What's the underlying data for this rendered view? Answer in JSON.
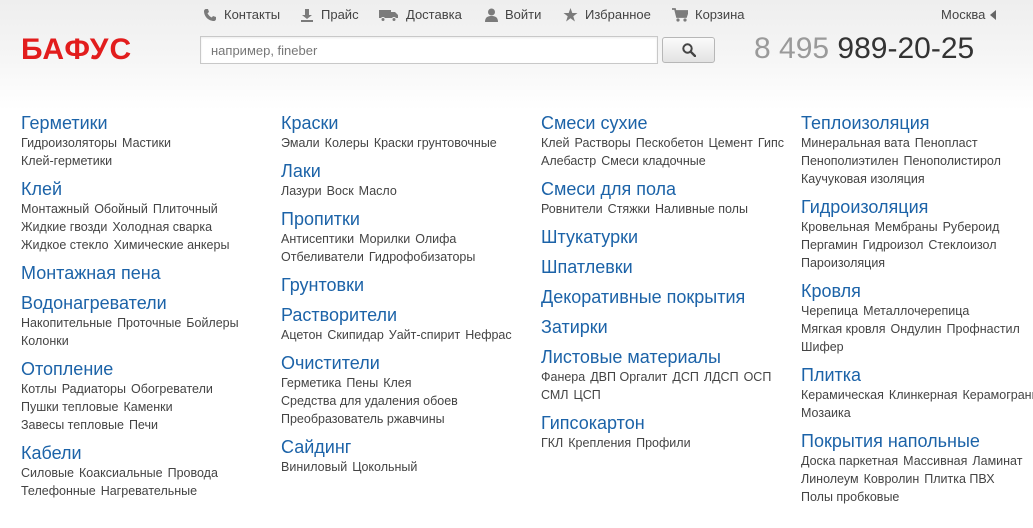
{
  "topnav": {
    "contacts": "Контакты",
    "price": "Прайс",
    "delivery": "Доставка",
    "login": "Войти",
    "favorites": "Избранное",
    "cart": "Корзина"
  },
  "city": "Москва",
  "logo": "БАФУС",
  "search": {
    "placeholder": "например, fineber"
  },
  "phone": {
    "code": "8 495",
    "number": "989-20-25"
  },
  "colors": {
    "brand": "#e21d1d",
    "link": "#1c63a8"
  },
  "columns": [
    [
      {
        "title": "Герметики",
        "subs": [
          "Гидроизоляторы",
          "Мастики",
          "Клей-герметики"
        ]
      },
      {
        "title": "Клей",
        "subs": [
          "Монтажный",
          "Обойный",
          "Плиточный",
          "Жидкие гвозди",
          "Холодная сварка",
          "Жидкое стекло",
          "Химические анкеры"
        ]
      },
      {
        "title": "Монтажная пена",
        "subs": []
      },
      {
        "title": "Водонагреватели",
        "subs": [
          "Накопительные",
          "Проточные",
          "Бойлеры",
          "Колонки"
        ]
      },
      {
        "title": "Отопление",
        "subs": [
          "Котлы",
          "Радиаторы",
          "Обогреватели",
          "Пушки тепловые",
          "Каменки",
          "Завесы тепловые",
          "Печи"
        ]
      },
      {
        "title": "Кабели",
        "subs": [
          "Силовые",
          "Коаксиальные",
          "Провода",
          "Телефонные",
          "Нагревательные"
        ]
      }
    ],
    [
      {
        "title": "Краски",
        "subs": [
          "Эмали",
          "Колеры",
          "Краски грунтовочные"
        ]
      },
      {
        "title": "Лаки",
        "subs": [
          "Лазури",
          "Воск",
          "Масло"
        ]
      },
      {
        "title": "Пропитки",
        "subs": [
          "Антисептики",
          "Морилки",
          "Олифа",
          "Отбеливатели",
          "Гидрофобизаторы"
        ]
      },
      {
        "title": "Грунтовки",
        "subs": []
      },
      {
        "title": "Растворители",
        "subs": [
          "Ацетон",
          "Скипидар",
          "Уайт-спирит",
          "Нефрас"
        ]
      },
      {
        "title": "Очистители",
        "subs": [
          "Герметика",
          "Пены",
          "Клея",
          "Средства для удаления обоев",
          "Преобразователь ржавчины"
        ]
      },
      {
        "title": "Сайдинг",
        "subs": [
          "Виниловый",
          "Цокольный"
        ]
      }
    ],
    [
      {
        "title": "Смеси сухие",
        "subs": [
          "Клей",
          "Растворы",
          "Пескобетон",
          "Цемент",
          "Гипс",
          "Алебастр",
          "Смеси кладочные"
        ]
      },
      {
        "title": "Смеси для пола",
        "subs": [
          "Ровнители",
          "Стяжки",
          "Наливные полы"
        ]
      },
      {
        "title": "Штукатурки",
        "subs": []
      },
      {
        "title": "Шпатлевки",
        "subs": []
      },
      {
        "title": "Декоративные покрытия",
        "subs": []
      },
      {
        "title": "Затирки",
        "subs": []
      },
      {
        "title": "Листовые материалы",
        "subs": [
          "Фанера",
          "ДВП Оргалит",
          "ДСП",
          "ЛДСП",
          "ОСП",
          "СМЛ",
          "ЦСП"
        ]
      },
      {
        "title": "Гипсокартон",
        "subs": [
          "ГКЛ",
          "Крепления",
          "Профили"
        ]
      }
    ],
    [
      {
        "title": "Теплоизоляция",
        "subs": [
          "Минеральная вата",
          "Пенопласт",
          "Пенополиэтилен",
          "Пенополистирол",
          "Каучуковая изоляция"
        ]
      },
      {
        "title": "Гидроизоляция",
        "subs": [
          "Кровельная",
          "Мембраны",
          "Рубероид",
          "Пергамин",
          "Гидроизол",
          "Стеклоизол",
          "Пароизоляция"
        ]
      },
      {
        "title": "Кровля",
        "subs": [
          "Черепица",
          "Металлочерепица",
          "Мягкая кровля",
          "Ондулин",
          "Профнастил",
          "Шифер"
        ]
      },
      {
        "title": "Плитка",
        "subs": [
          "Керамическая",
          "Клинкерная",
          "Керамогранит",
          "Мозаика"
        ]
      },
      {
        "title": "Покрытия напольные",
        "subs": [
          "Доска паркетная",
          "Массивная",
          "Ламинат",
          "Линолеум",
          "Ковролин",
          "Плитка ПВХ",
          "Полы пробковые"
        ]
      }
    ]
  ]
}
